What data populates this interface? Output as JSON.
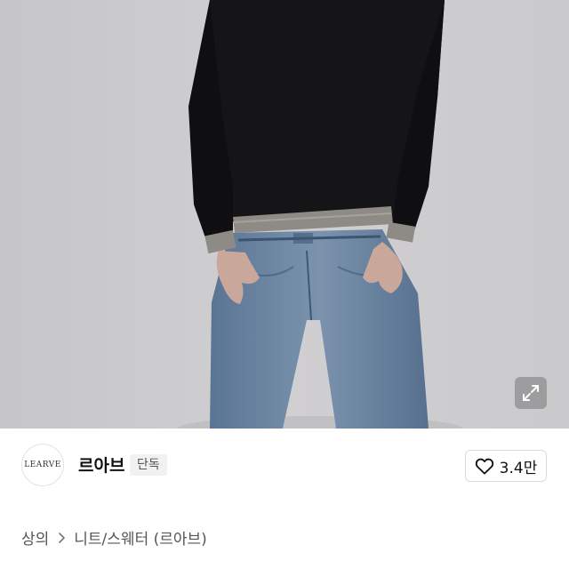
{
  "hero": {
    "image_subject": "model wearing black knit sweater and blue denim jeans"
  },
  "brand": {
    "logo_text": "LEARVE",
    "name": "르아브",
    "badge": "단독"
  },
  "like": {
    "icon": "heart-icon",
    "count": "3.4만"
  },
  "breadcrumb": {
    "category": "상의",
    "separator_icon": "chevron-right-icon",
    "subcategory": "니트/스웨터 (르아브)"
  },
  "colors": {
    "background": "#ffffff",
    "hero_backdrop": "#cccbcd",
    "text_primary": "#111111",
    "text_secondary": "#555555",
    "badge_bg": "#f1f1f1",
    "border": "#d9d9d9"
  }
}
